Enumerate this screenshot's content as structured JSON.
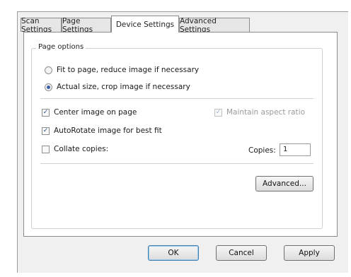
{
  "tabs": [
    {
      "label": "Scan Settings",
      "active": false
    },
    {
      "label": "Page Settings",
      "active": false
    },
    {
      "label": "Device Settings",
      "active": true
    },
    {
      "label": "Advanced Settings",
      "active": false
    }
  ],
  "page_options": {
    "legend": "Page options",
    "radio_fit": {
      "label": "Fit to page, reduce image if necessary",
      "selected": false
    },
    "radio_actual": {
      "label": "Actual size, crop image if necessary",
      "selected": true
    },
    "center_image": {
      "label": "Center image on page",
      "checked": true
    },
    "maintain_aspect": {
      "label": "Maintain aspect ratio",
      "checked": true,
      "enabled": false
    },
    "autorotate": {
      "label": "AutoRotate image for best fit",
      "checked": true
    },
    "collate": {
      "label": "Collate copies:",
      "checked": false
    },
    "copies_label": "Copies:",
    "copies_value": "1",
    "advanced_button": "Advanced..."
  },
  "buttons": {
    "ok": "OK",
    "cancel": "Cancel",
    "apply": "Apply"
  },
  "colors": {
    "selection_blue": "#3a5fa0",
    "default_button_border": "#3c7fb1"
  }
}
